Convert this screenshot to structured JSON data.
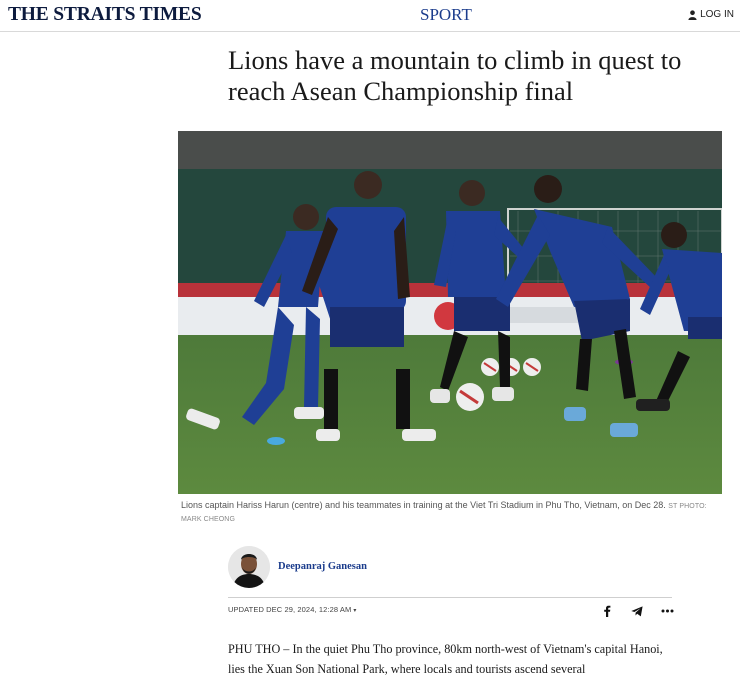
{
  "header": {
    "masthead": "THE STRAITS TIMES",
    "section": "SPORT",
    "login_label": "LOG IN"
  },
  "article": {
    "headline": "Lions have a mountain to climb in quest to reach Asean Championship final",
    "photo_alt": "Lions captain Hariss Harun (centre) and his teammates in training",
    "caption": "Lions captain Hariss Harun (centre) and his teammates in training at the Viet Tri Stadium in Phu Tho, Vietnam, on Dec 28.",
    "credit": "ST PHOTO: MARK CHEONG",
    "author": "Deepanraj Ganesan",
    "updated": "UPDATED DEC 29, 2024, 12:28 AM",
    "updated_caret": "▾",
    "body_first": "PHU THO – In the quiet Phu Tho province, 80km north-west of Vietnam's capital Hanoi, lies the Xuan Son National Park, where locals and tourists ascend several"
  },
  "share": {
    "icons": [
      "facebook-icon",
      "telegram-icon",
      "more-icon"
    ]
  },
  "colors": {
    "masthead": "#0d1b3e",
    "section": "#1b3c8c",
    "author": "#1b3c8c",
    "jersey": "#1f3f95"
  }
}
